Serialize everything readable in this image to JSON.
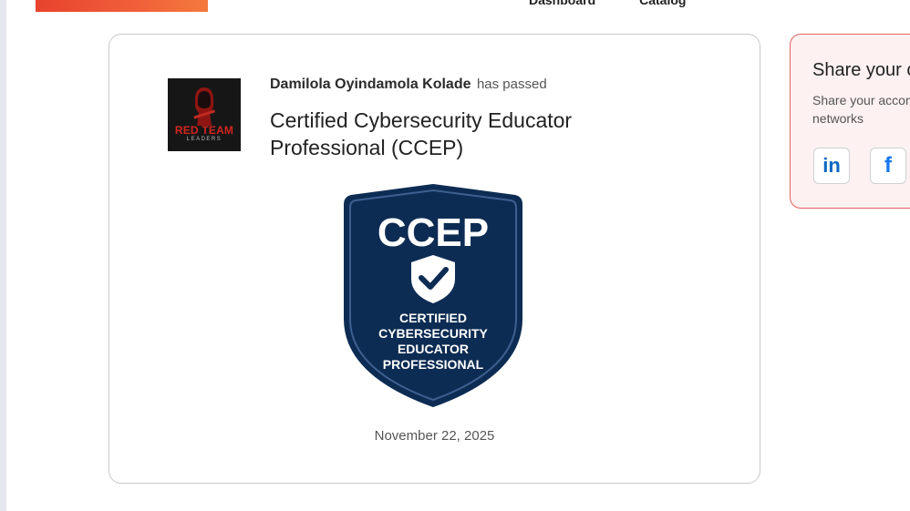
{
  "nav": {
    "items": [
      {
        "label": "Dashboard"
      },
      {
        "label": "Catalog"
      }
    ]
  },
  "colors": {
    "banner": "#e8432e",
    "badge_navy": "#0d2c53",
    "share_border": "#e06060",
    "linkedin": "#0a66c2",
    "facebook": "#1877f2"
  },
  "certificate": {
    "issuer_logo": {
      "line1": "RED TEAM",
      "line2": "LEADERS"
    },
    "recipient_name": "Damilola Oyindamola Kolade",
    "passed_text": "has passed",
    "title": "Certified Cybersecurity Educator Professional (CCEP)",
    "badge": {
      "acronym": "CCEP",
      "lines": [
        "CERTIFIED",
        "CYBERSECURITY",
        "EDUCATOR",
        "PROFESSIONAL"
      ],
      "icon": "shield-check-icon"
    },
    "date": "November 22, 2025"
  },
  "share": {
    "title": "Share your c",
    "description_line1": "Share your accom",
    "description_line2": "networks",
    "buttons": [
      {
        "label": "in",
        "icon": "linkedin-icon"
      },
      {
        "label": "f",
        "icon": "facebook-icon"
      }
    ]
  }
}
